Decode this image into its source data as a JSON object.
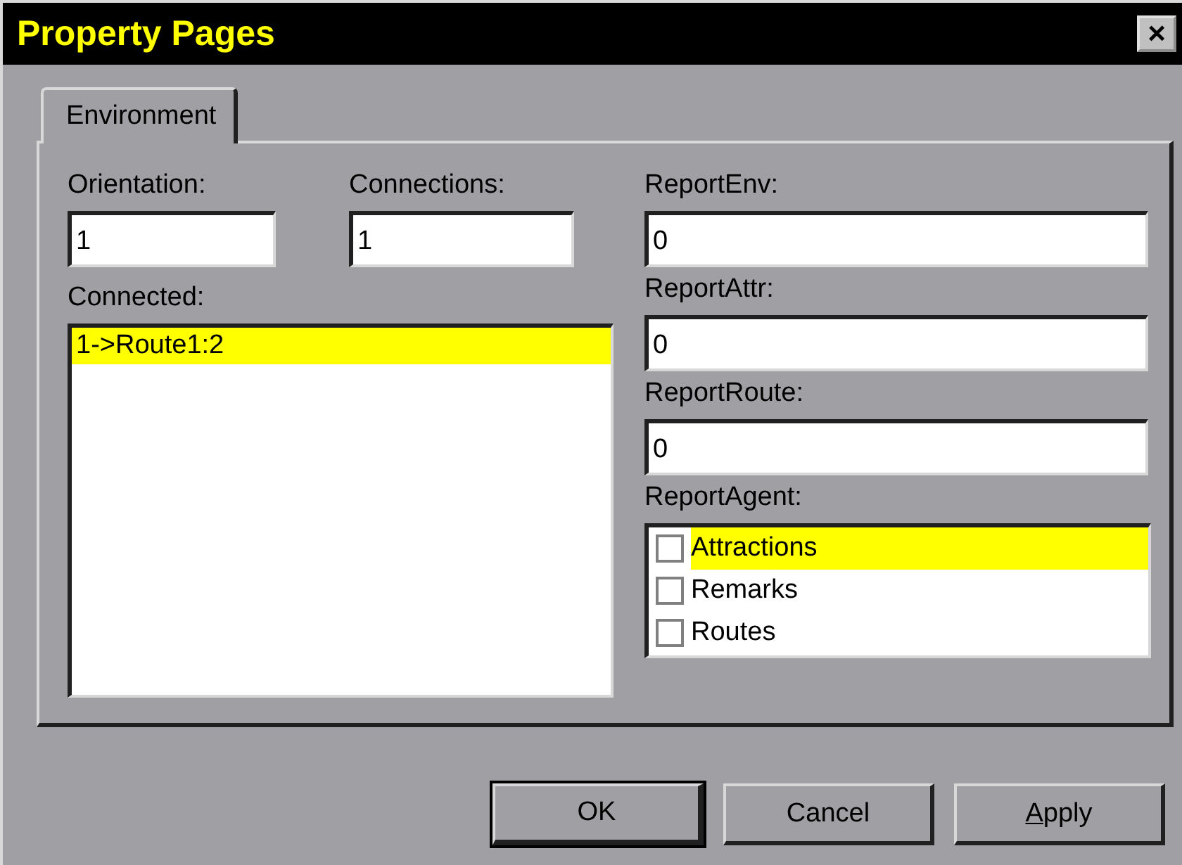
{
  "window": {
    "title": "Property Pages",
    "close": "×"
  },
  "tabs": [
    {
      "label": "Environment",
      "selected": true
    }
  ],
  "fields": {
    "orientation": {
      "label": "Orientation:",
      "value": "1"
    },
    "connections": {
      "label": "Connections:",
      "value": "1"
    },
    "report_env": {
      "label": "ReportEnv:",
      "value": "0"
    },
    "report_attr": {
      "label": "ReportAttr:",
      "value": "0"
    },
    "report_route": {
      "label": "ReportRoute:",
      "value": "0"
    }
  },
  "connected": {
    "label": "Connected:",
    "items": [
      {
        "text": "1->Route1:2",
        "selected": true
      }
    ]
  },
  "report_agent": {
    "label": "ReportAgent:",
    "items": [
      {
        "text": "Attractions",
        "checked": false,
        "selected": true
      },
      {
        "text": "Remarks",
        "checked": false,
        "selected": false
      },
      {
        "text": "Routes",
        "checked": false,
        "selected": false
      }
    ]
  },
  "buttons": [
    {
      "label": "OK",
      "default": true,
      "underline_first": false
    },
    {
      "label": "Cancel",
      "default": false,
      "underline_first": false
    },
    {
      "label": "Apply",
      "default": false,
      "underline_first": true
    }
  ]
}
